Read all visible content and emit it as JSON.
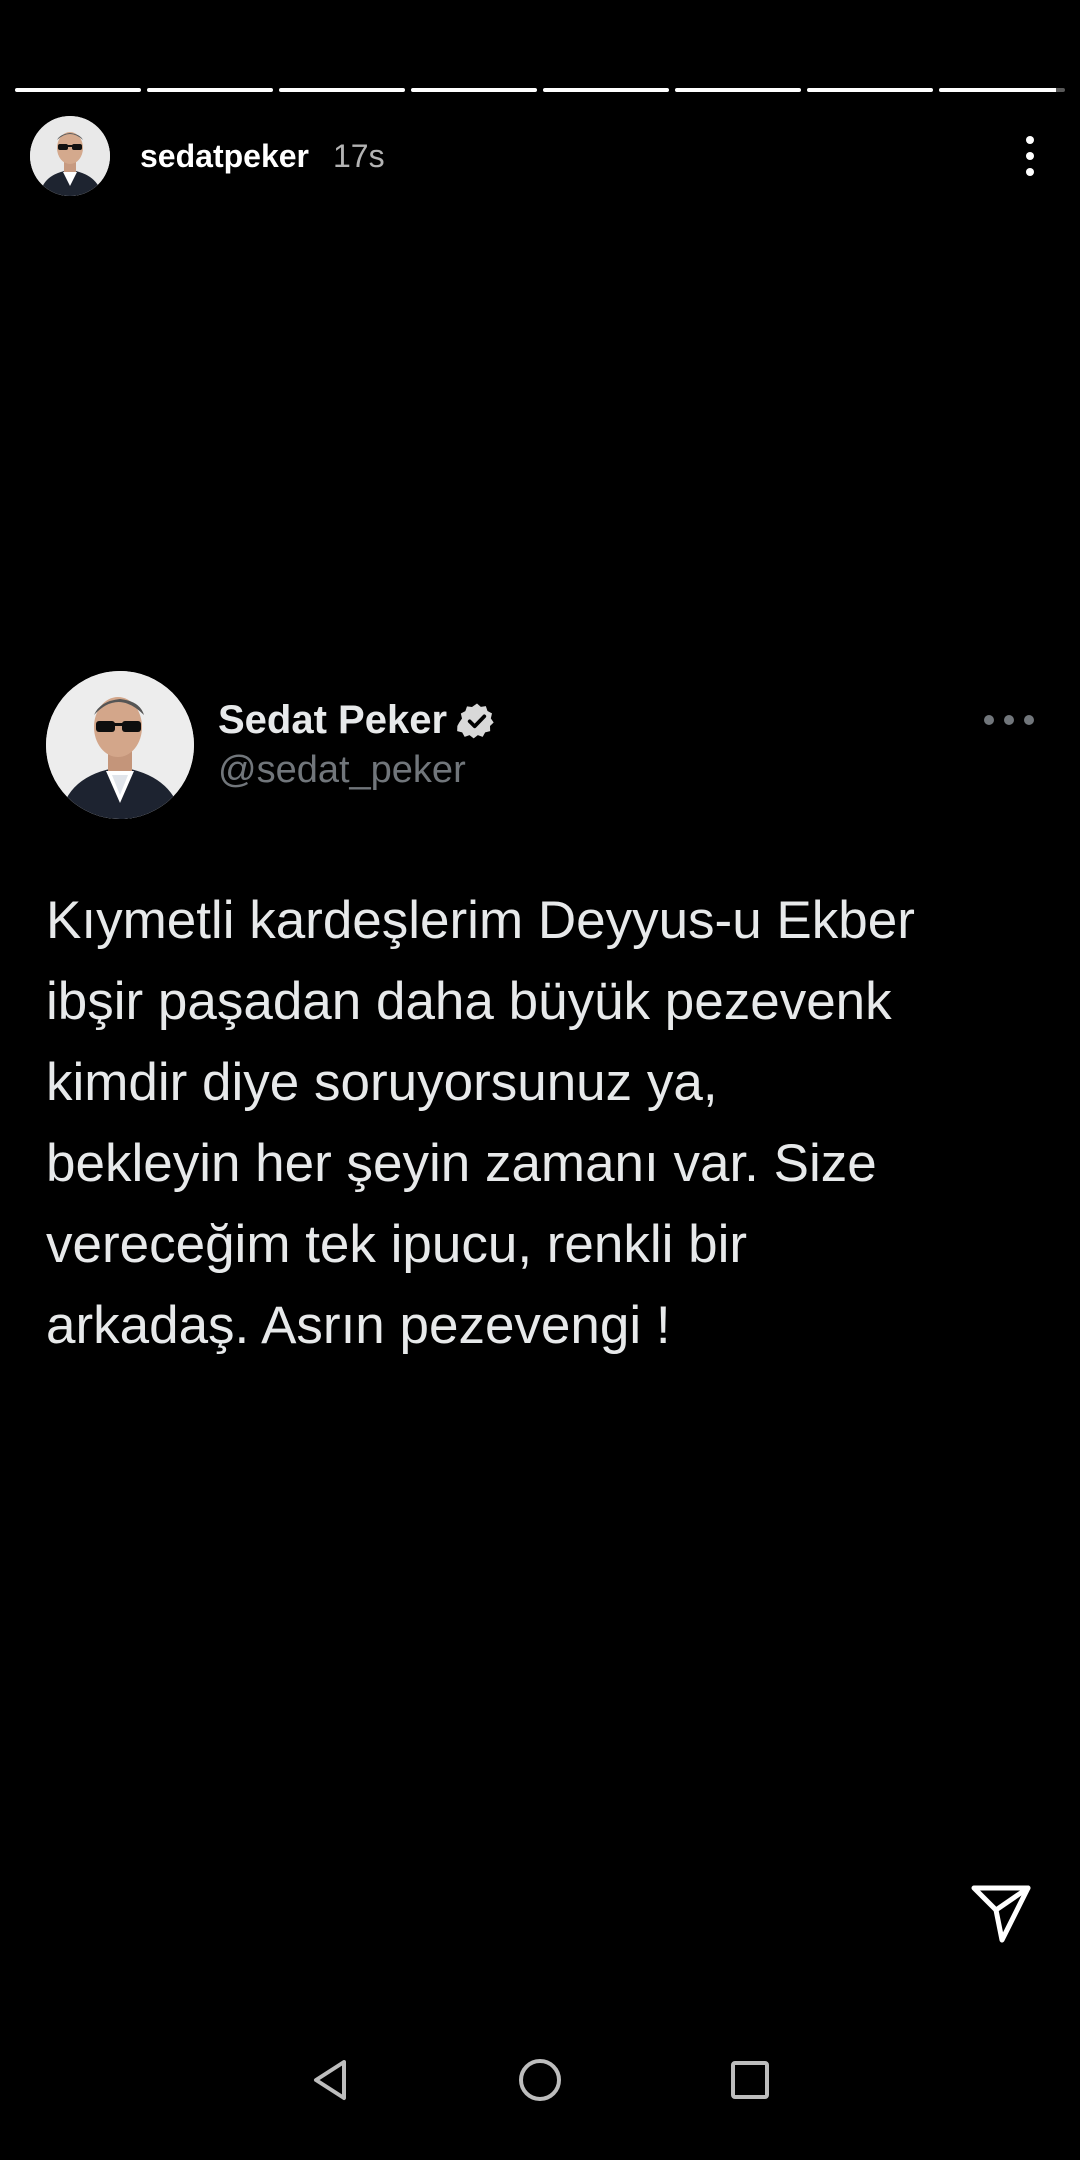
{
  "story": {
    "progress_segments": [
      1,
      1,
      1,
      1,
      1,
      1,
      1,
      0.93
    ],
    "username": "sedatpeker",
    "time": "17s",
    "avatar_icon": "user-photo",
    "more_icon": "more-vertical-icon"
  },
  "tweet": {
    "name": "Sedat Peker",
    "handle": "@sedat_peker",
    "verified_icon": "verified-badge-icon",
    "more_icon": "more-horizontal-icon",
    "text": "Kıymetli kardeşlerim Deyyus-u Ekber\nibşir paşadan daha büyük pezevenk\nkimdir diye soruyorsunuz ya,\nbekleyin her şeyin zamanı var. Size\nvereceğim tek ipucu, renkli bir\narkadaş. Asrın pezevengi !"
  },
  "actions": {
    "send_icon": "send-icon"
  },
  "navbar": {
    "back_icon": "back-icon",
    "home_icon": "home-icon",
    "recents_icon": "recents-icon"
  },
  "colors": {
    "background": "#000000",
    "primary_text": "#e7e9ea",
    "secondary_text": "#71767b",
    "progress_track": "rgba(255,255,255,0.35)",
    "progress_fill": "#ffffff"
  }
}
